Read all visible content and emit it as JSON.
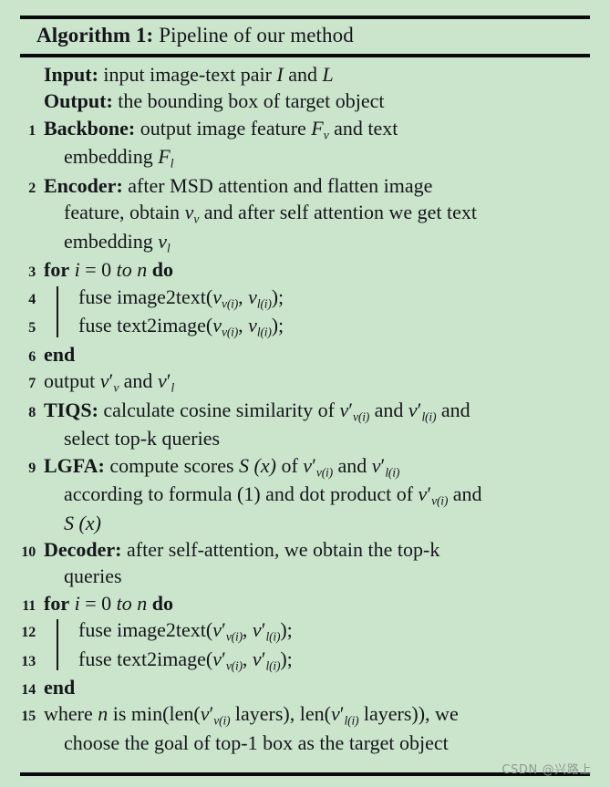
{
  "algorithm": {
    "label": "Algorithm 1:",
    "title": "Pipeline of our method",
    "input_label": "Input:",
    "input_text_a": "input image-text pair ",
    "input_var1": "I",
    "input_and": " and ",
    "input_var2": "L",
    "output_label": "Output:",
    "output_text": "the bounding box of target object"
  },
  "lines": {
    "n1": "1",
    "n2": "2",
    "n3": "3",
    "n4": "4",
    "n5": "5",
    "n6": "6",
    "n7": "7",
    "n8": "8",
    "n9": "9",
    "n10": "10",
    "n11": "11",
    "n12": "12",
    "n13": "13",
    "n14": "14",
    "n15": "15"
  },
  "steps": {
    "backbone_label": "Backbone:",
    "backbone_a": " output image feature ",
    "backbone_F": "F",
    "backbone_Fsub": "v",
    "backbone_b": " and text",
    "backbone_c": "embedding ",
    "backbone_F2": "F",
    "backbone_F2sub": "l",
    "encoder_label": "Encoder:",
    "encoder_a": " after MSD attention and flatten image",
    "encoder_b": "feature, obtain ",
    "encoder_v": "v",
    "encoder_vsub": "v",
    "encoder_c": " and after self attention we get text",
    "encoder_d": "embedding ",
    "encoder_v2": "v",
    "encoder_v2sub": "l",
    "for_kw": "for",
    "for_i": "i",
    "for_eq": " = 0 ",
    "for_to": "to",
    "for_n": "n",
    "for_do": "do",
    "end_kw": "end",
    "fuse_i2t": "fuse image2text(",
    "fuse_t2i": "fuse text2image(",
    "comma": ", ",
    "close": ");",
    "output_kw": "output ",
    "output_and": " and ",
    "tiqs_label": "TIQS:",
    "tiqs_a": " calculate cosine similarity of ",
    "tiqs_and": " and ",
    "tiqs_and2": " and",
    "tiqs_b": "select top-k queries",
    "lgfa_label": "LGFA:",
    "lgfa_a": " compute scores ",
    "lgfa_S": "S",
    "lgfa_x": " (x)",
    "lgfa_of": " of ",
    "lgfa_and": " and ",
    "lgfa_b": "according to formula (1) and dot product of ",
    "lgfa_c": " and",
    "decoder_label": "Decoder:",
    "decoder_a": " after self-attention, we obtain the top-k",
    "decoder_b": "queries",
    "where_a": "where ",
    "where_n": "n",
    "where_b": " is min(len(",
    "where_layers1": " layers), len(",
    "where_layers2": " layers)), we",
    "where_c": "choose the goal of top-1 box as the target object"
  },
  "vars": {
    "v": "v",
    "sub_vi": "v(i)",
    "sub_li": "l(i)",
    "sub_v": "v",
    "sub_l": "l",
    "prime": "′"
  },
  "watermark": "CSDN @兴路上",
  "colors": {
    "background": "#cbe5cd",
    "ink": "#15161a"
  }
}
